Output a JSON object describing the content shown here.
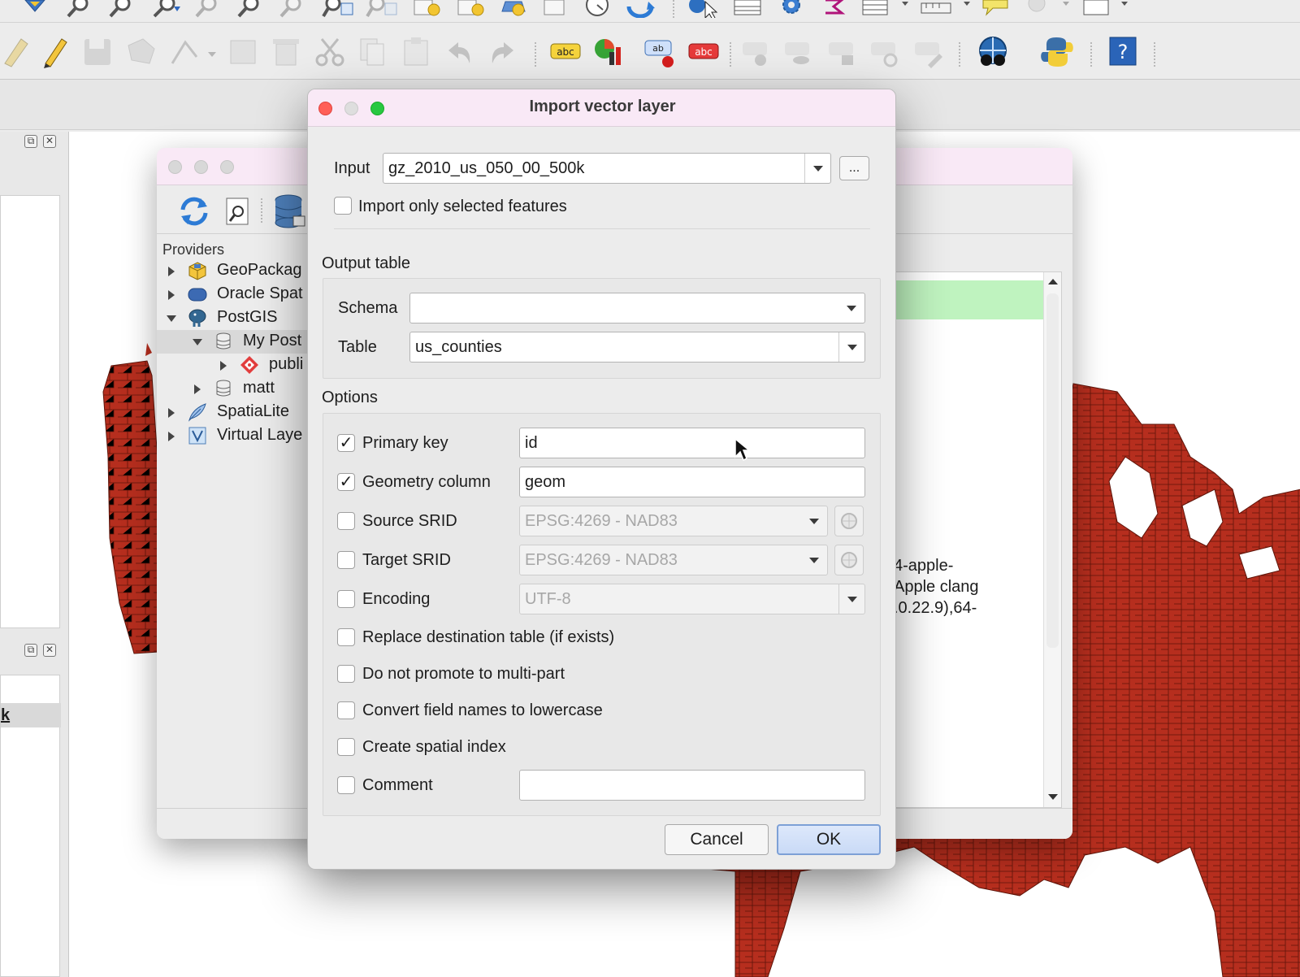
{
  "dialog": {
    "title": "Import vector layer",
    "input_label": "Input",
    "input_value": "gz_2010_us_050_00_500k",
    "browse_label": "...",
    "import_selected_label": "Import only selected features",
    "import_selected_checked": false,
    "output_table_header": "Output table",
    "schema_label": "Schema",
    "schema_value": "",
    "table_label": "Table",
    "table_value": "us_counties",
    "options_header": "Options",
    "options": {
      "primary_key": {
        "label": "Primary key",
        "checked": true,
        "value": "id"
      },
      "geometry_column": {
        "label": "Geometry column",
        "checked": true,
        "value": "geom"
      },
      "source_srid": {
        "label": "Source SRID",
        "checked": false,
        "value": "EPSG:4269 - NAD83"
      },
      "target_srid": {
        "label": "Target SRID",
        "checked": false,
        "value": "EPSG:4269 - NAD83"
      },
      "encoding": {
        "label": "Encoding",
        "checked": false,
        "value": "UTF-8"
      },
      "replace_table": {
        "label": "Replace destination table (if exists)",
        "checked": false
      },
      "no_multipart": {
        "label": "Do not promote to multi-part",
        "checked": false
      },
      "lowercase": {
        "label": "Convert field names to lowercase",
        "checked": false
      },
      "spatial_index": {
        "label": "Create spatial index",
        "checked": false
      },
      "comment": {
        "label": "Comment",
        "checked": false,
        "value": ""
      }
    },
    "cancel_label": "Cancel",
    "ok_label": "OK"
  },
  "browser": {
    "providers_label": "Providers",
    "tree": [
      {
        "label": "GeoPackag",
        "icon": "geopackage-icon",
        "expanded": false
      },
      {
        "label": "Oracle Spat",
        "icon": "oracle-icon",
        "expanded": false
      },
      {
        "label": "PostGIS",
        "icon": "postgis-elephant-icon",
        "expanded": true
      },
      {
        "label": "My Post",
        "icon": "database-icon",
        "expanded": true,
        "selected": true
      },
      {
        "label": "publi",
        "icon": "schema-icon",
        "expanded": false
      },
      {
        "label": "matt",
        "icon": "database-icon",
        "expanded": false
      },
      {
        "label": "SpatiaLite",
        "icon": "spatialite-feather-icon",
        "expanded": false
      },
      {
        "label": "Virtual Laye",
        "icon": "virtual-layer-icon",
        "expanded": false
      }
    ],
    "info_lines": [
      "4-apple-",
      "Apple clang",
      ".0.22.9),64-"
    ]
  },
  "dock": {
    "item_label": "k"
  },
  "colors": {
    "map_fill": "#b62e1e",
    "map_stroke": "#5e1409",
    "title_bar": "#f9e9f6",
    "selection": "#d9d9d9",
    "info_highlight": "#bff3bf",
    "ok_button": "#c9daf6"
  }
}
